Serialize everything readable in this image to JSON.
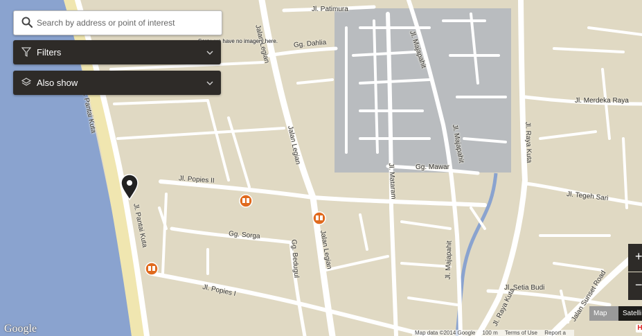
{
  "search": {
    "placeholder": "Search by address or point of interest"
  },
  "filters": {
    "label": "Filters"
  },
  "also_show": {
    "label": "Also show"
  },
  "no_imagery": "Sorry, we have no imagery here.",
  "road_labels": {
    "patimura": "Jl. Patimura",
    "dahlia": "Gg. Dahlia",
    "majapahit_n": "Jl. Majapahit",
    "majapahit_c": "Jl. Majapahit",
    "majapahit_s": "Jl. Majapahit",
    "merdeka": "Jl. Merdeka Raya",
    "pantai_kuta_n": "Jl. Pantai Kuta",
    "pantai_kuta_s": "Jl. Pantai Kuta",
    "legian_n": "Jalan Legian",
    "legian_c": "Jalan Legian",
    "legian_s": "Jalan Legian",
    "raya_kuta_n": "Jl. Raya Kuta",
    "raya_kuta_s": "Jl. Raya Kuta",
    "mataram": "Jl. Mataram",
    "mawar": "Gg. Mawar",
    "popies2": "Jl. Popies II",
    "tegeh_sari": "Jl. Tegeh Sari",
    "sorga": "Gg. Sorga",
    "bedugul": "Gg. Bedugul",
    "popies1": "Jl. Popies I",
    "setia_budi": "Jl. Setia Budi",
    "sunset": "Jalan Sunset Road"
  },
  "map_type": {
    "map": "Map",
    "satellite": "Satelli"
  },
  "zoom": {
    "in": "+",
    "out": "−"
  },
  "logo": "Google",
  "attribution": {
    "data": "Map data ©2014 Google",
    "scale": "100 m",
    "terms": "Terms of Use",
    "report": "Report a"
  },
  "badge": "H",
  "colors": {
    "land": "#e0d9c3",
    "road": "#ffffff",
    "water": "#8aa3cf",
    "beach": "#f0e6b0",
    "no_imagery": "#b9bcbf",
    "panel": "#2e2b28",
    "poi": "#e06a1e"
  },
  "icons": [
    "search-icon",
    "filter-icon",
    "layers-icon",
    "chevron-down-icon",
    "location-pin-icon",
    "binoculars-icon"
  ]
}
